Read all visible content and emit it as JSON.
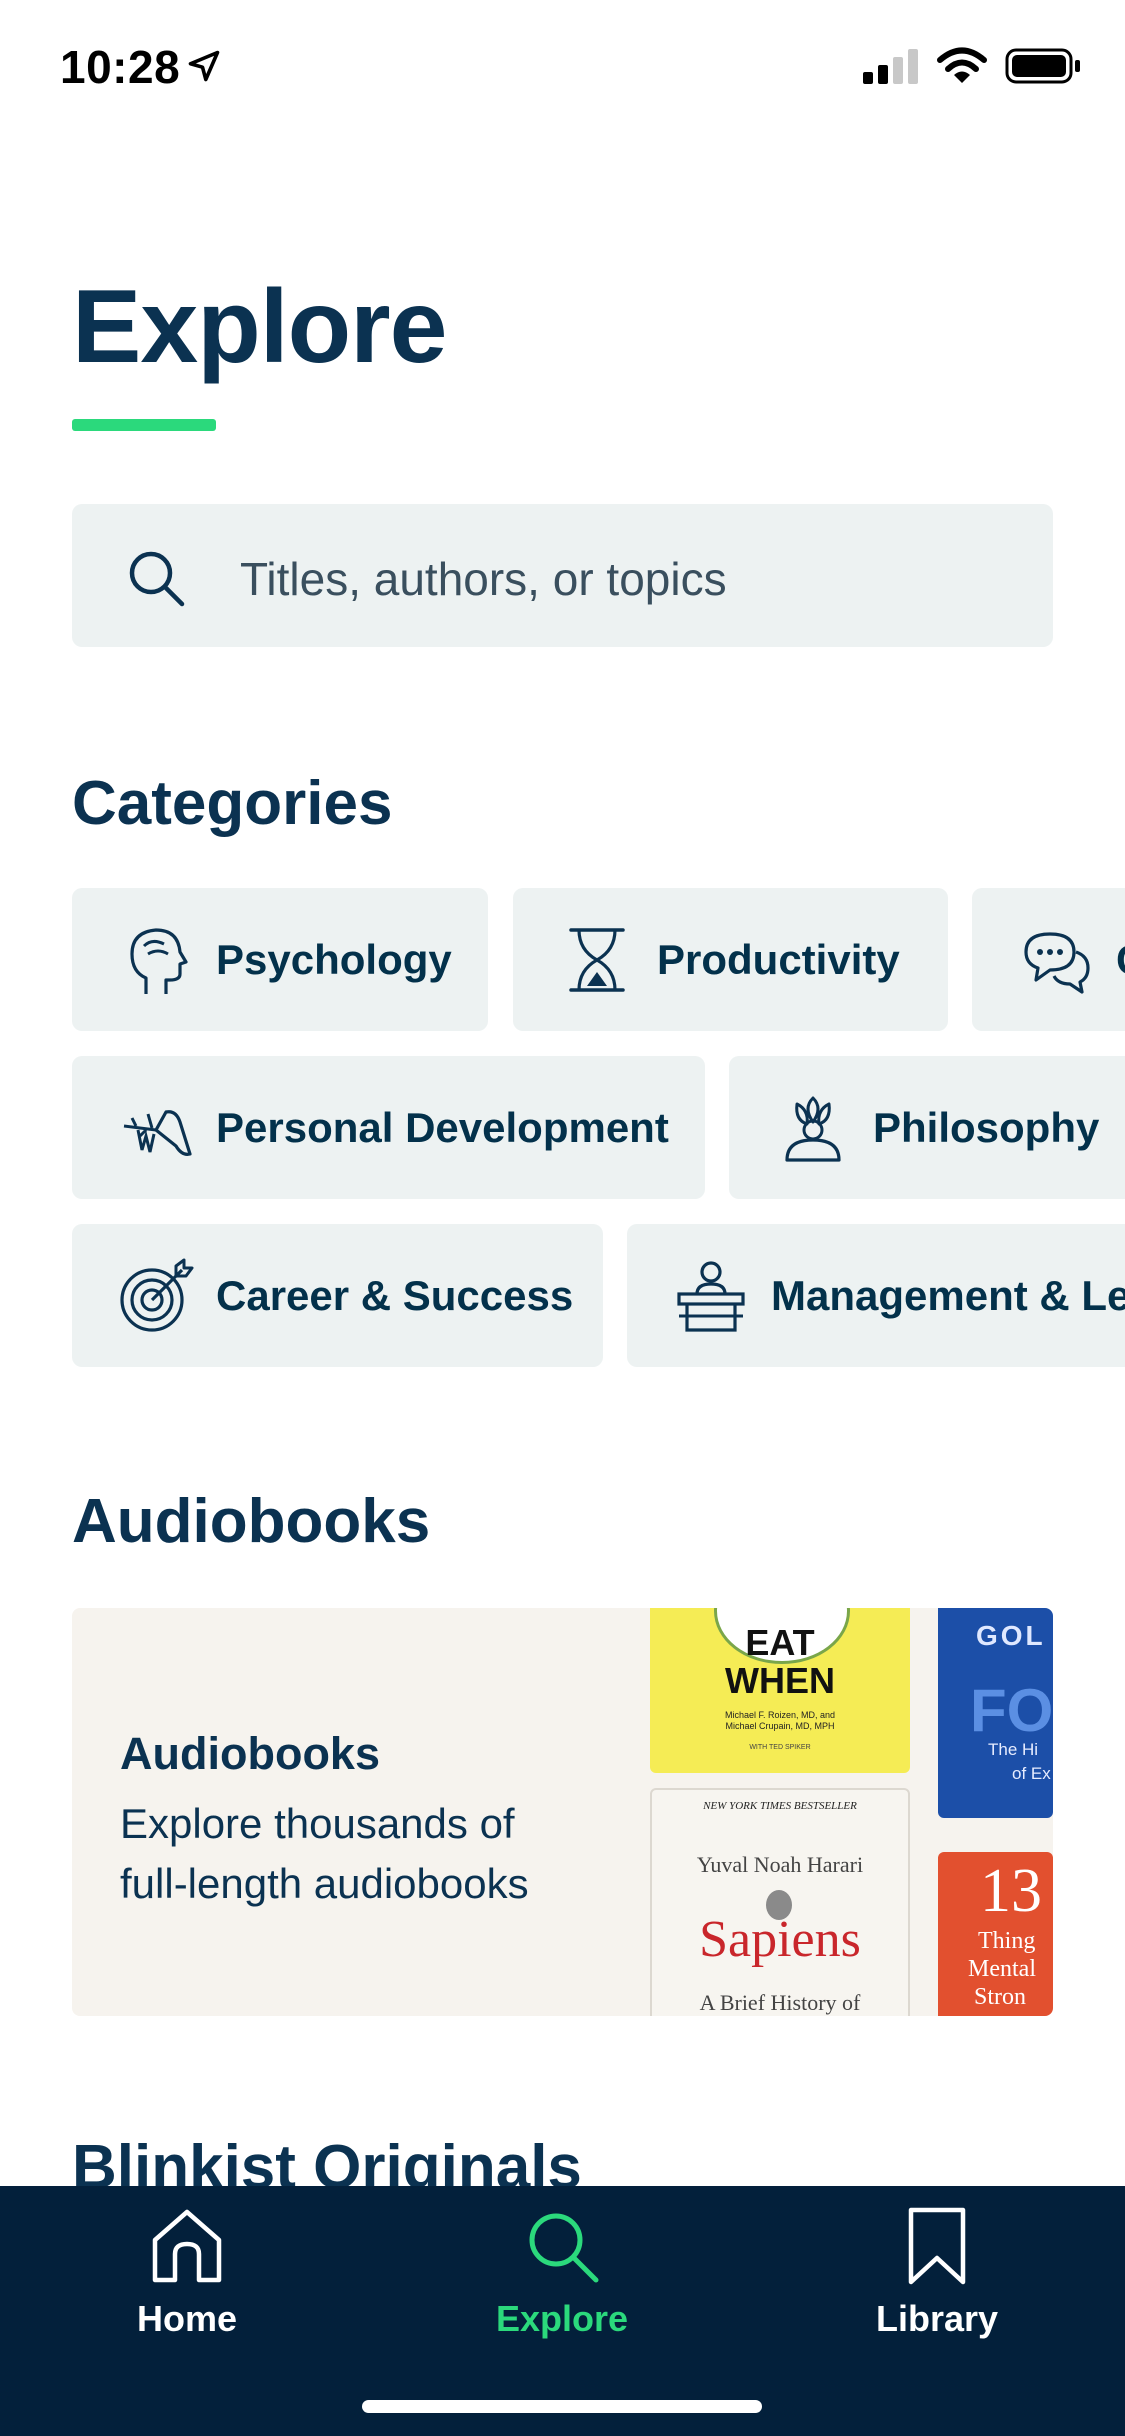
{
  "status_bar": {
    "time": "10:28",
    "icons": [
      "location-arrow-icon",
      "cellular-signal-icon",
      "wifi-icon",
      "battery-icon"
    ]
  },
  "header": {
    "title": "Explore"
  },
  "search": {
    "placeholder": "Titles, authors, or topics",
    "value": ""
  },
  "categories": {
    "title": "Categories",
    "items": [
      {
        "label": "Psychology",
        "icon": "head-profile-icon"
      },
      {
        "label": "Productivity",
        "icon": "hourglass-icon"
      },
      {
        "label": "C",
        "icon": "speech-bubbles-icon"
      },
      {
        "label": "Personal Development",
        "icon": "swiss-knife-icon"
      },
      {
        "label": "Philosophy",
        "icon": "lotus-icon"
      },
      {
        "label": "Career & Success",
        "icon": "target-icon"
      },
      {
        "label": "Management & Le",
        "icon": "podium-icon"
      }
    ]
  },
  "audiobooks": {
    "title": "Audiobooks",
    "card": {
      "title": "Audiobooks",
      "description": "Explore thousands of full-length audiobooks"
    },
    "covers": {
      "eat_when": {
        "word1": "EAT",
        "word2": "WHEN",
        "authors": "Michael F. Roizen, MD, and Michael Crupain, MD, MPH",
        "extra": "WITH TED SPIKER"
      },
      "sapiens": {
        "banner": "NEW YORK TIMES BESTSELLER",
        "author": "Yuval Noah Harari",
        "title": "Sapiens",
        "subtitle": "A Brief History of"
      },
      "focus": {
        "author": "GOL",
        "title": "FO",
        "subtitle": "The Hi",
        "subtitle2": "of Ex"
      },
      "things": {
        "number": "13",
        "word1": "Thing",
        "word2": "Mental",
        "word3": "Stron"
      }
    }
  },
  "next_section": {
    "title": "Blinkist Originals"
  },
  "bottom_nav": {
    "items": [
      {
        "label": "Home",
        "icon": "home-icon",
        "active": false
      },
      {
        "label": "Explore",
        "icon": "search-icon",
        "active": true
      },
      {
        "label": "Library",
        "icon": "bookmark-icon",
        "active": false
      }
    ]
  },
  "colors": {
    "navy": "#0b3251",
    "accent_green": "#2bd97c",
    "chip_background": "#edf2f2",
    "nav_background": "#03203b",
    "card_background": "#f6f3ee"
  }
}
